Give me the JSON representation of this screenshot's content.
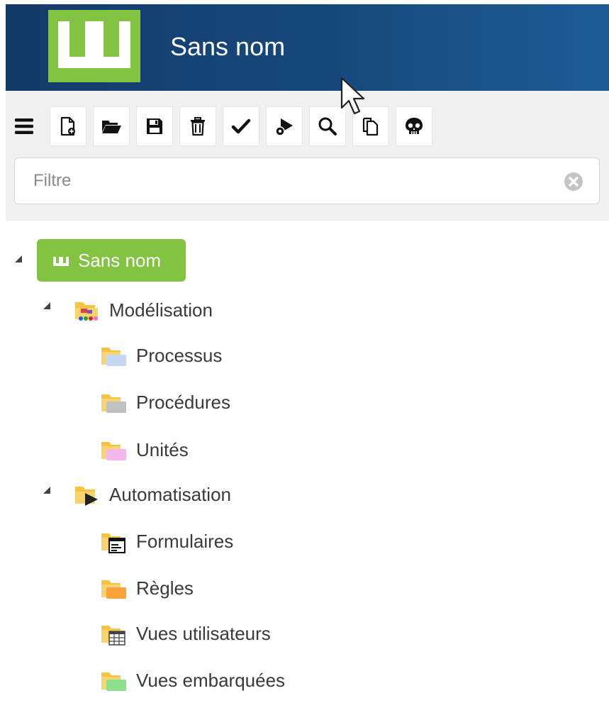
{
  "header": {
    "title": "Sans nom"
  },
  "toolbar": {
    "buttons": [
      {
        "name": "menu-button",
        "icon": "hamburger-icon"
      },
      {
        "name": "new-file-button",
        "icon": "new-file-icon"
      },
      {
        "name": "open-folder-button",
        "icon": "open-folder-icon"
      },
      {
        "name": "save-button",
        "icon": "floppy-disk-icon"
      },
      {
        "name": "delete-button",
        "icon": "trash-icon"
      },
      {
        "name": "validate-button",
        "icon": "check-icon"
      },
      {
        "name": "run-button",
        "icon": "play-gear-icon"
      },
      {
        "name": "search-button",
        "icon": "magnifier-icon"
      },
      {
        "name": "copy-button",
        "icon": "copy-icon"
      },
      {
        "name": "skull-button",
        "icon": "skull-icon"
      }
    ]
  },
  "filter": {
    "placeholder": "Filtre",
    "value": ""
  },
  "tree": {
    "root": {
      "label": "Sans nom",
      "expanded": true
    },
    "groups": [
      {
        "label": "Modélisation",
        "expanded": true,
        "icon": "modelisation-folder-icon",
        "children": [
          {
            "label": "Processus",
            "icon": "folder-blue-icon",
            "accent": "#c5d9f5"
          },
          {
            "label": "Procédures",
            "icon": "folder-gray-icon",
            "accent": "#c0c0c0"
          },
          {
            "label": "Unités",
            "icon": "folder-pink-icon",
            "accent": "#f4b6ef"
          }
        ]
      },
      {
        "label": "Automatisation",
        "expanded": true,
        "icon": "automatisation-folder-icon",
        "children": [
          {
            "label": "Formulaires",
            "icon": "folder-form-icon"
          },
          {
            "label": "Règles",
            "icon": "folder-orange-icon",
            "accent": "#f7a23c"
          },
          {
            "label": "Vues utilisateurs",
            "icon": "folder-grid-icon"
          },
          {
            "label": "Vues embarquées",
            "icon": "folder-green-icon",
            "accent": "#8ee08e"
          }
        ]
      }
    ]
  },
  "colors": {
    "header_start": "#133a69",
    "header_end": "#1d5c94",
    "brand_green": "#82c341",
    "folder_yellow": "#f5c242",
    "toolbar_bg": "#f1f1f1"
  }
}
